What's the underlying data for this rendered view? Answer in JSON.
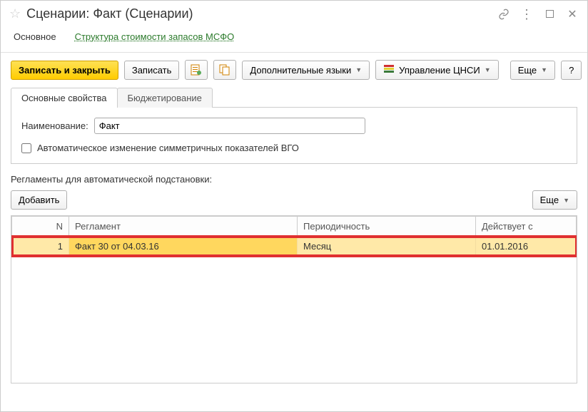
{
  "header": {
    "title": "Сценарии: Факт (Сценарии)"
  },
  "nav": {
    "main": "Основное",
    "link": "Структура стоимости запасов МСФО"
  },
  "toolbar": {
    "save_close": "Записать и закрыть",
    "save": "Записать",
    "more_langs": "Дополнительные языки",
    "cnsi": "Управление ЦНСИ",
    "more": "Еще",
    "help": "?"
  },
  "tabs": {
    "props": "Основные свойства",
    "budget": "Бюджетирование"
  },
  "form": {
    "name_label": "Наименование:",
    "name_value": "Факт",
    "auto_label": "Автоматическое изменение симметричных показателей ВГО"
  },
  "section": {
    "label": "Регламенты для автоматической подстановки:"
  },
  "subtoolbar": {
    "add": "Добавить",
    "more": "Еще"
  },
  "table": {
    "headers": {
      "n": "N",
      "reglament": "Регламент",
      "periodicity": "Периодичность",
      "valid_from": "Действует с"
    },
    "rows": [
      {
        "n": "1",
        "reglament": "Факт 30 от 04.03.16",
        "periodicity": "Месяц",
        "valid_from": "01.01.2016"
      }
    ]
  }
}
